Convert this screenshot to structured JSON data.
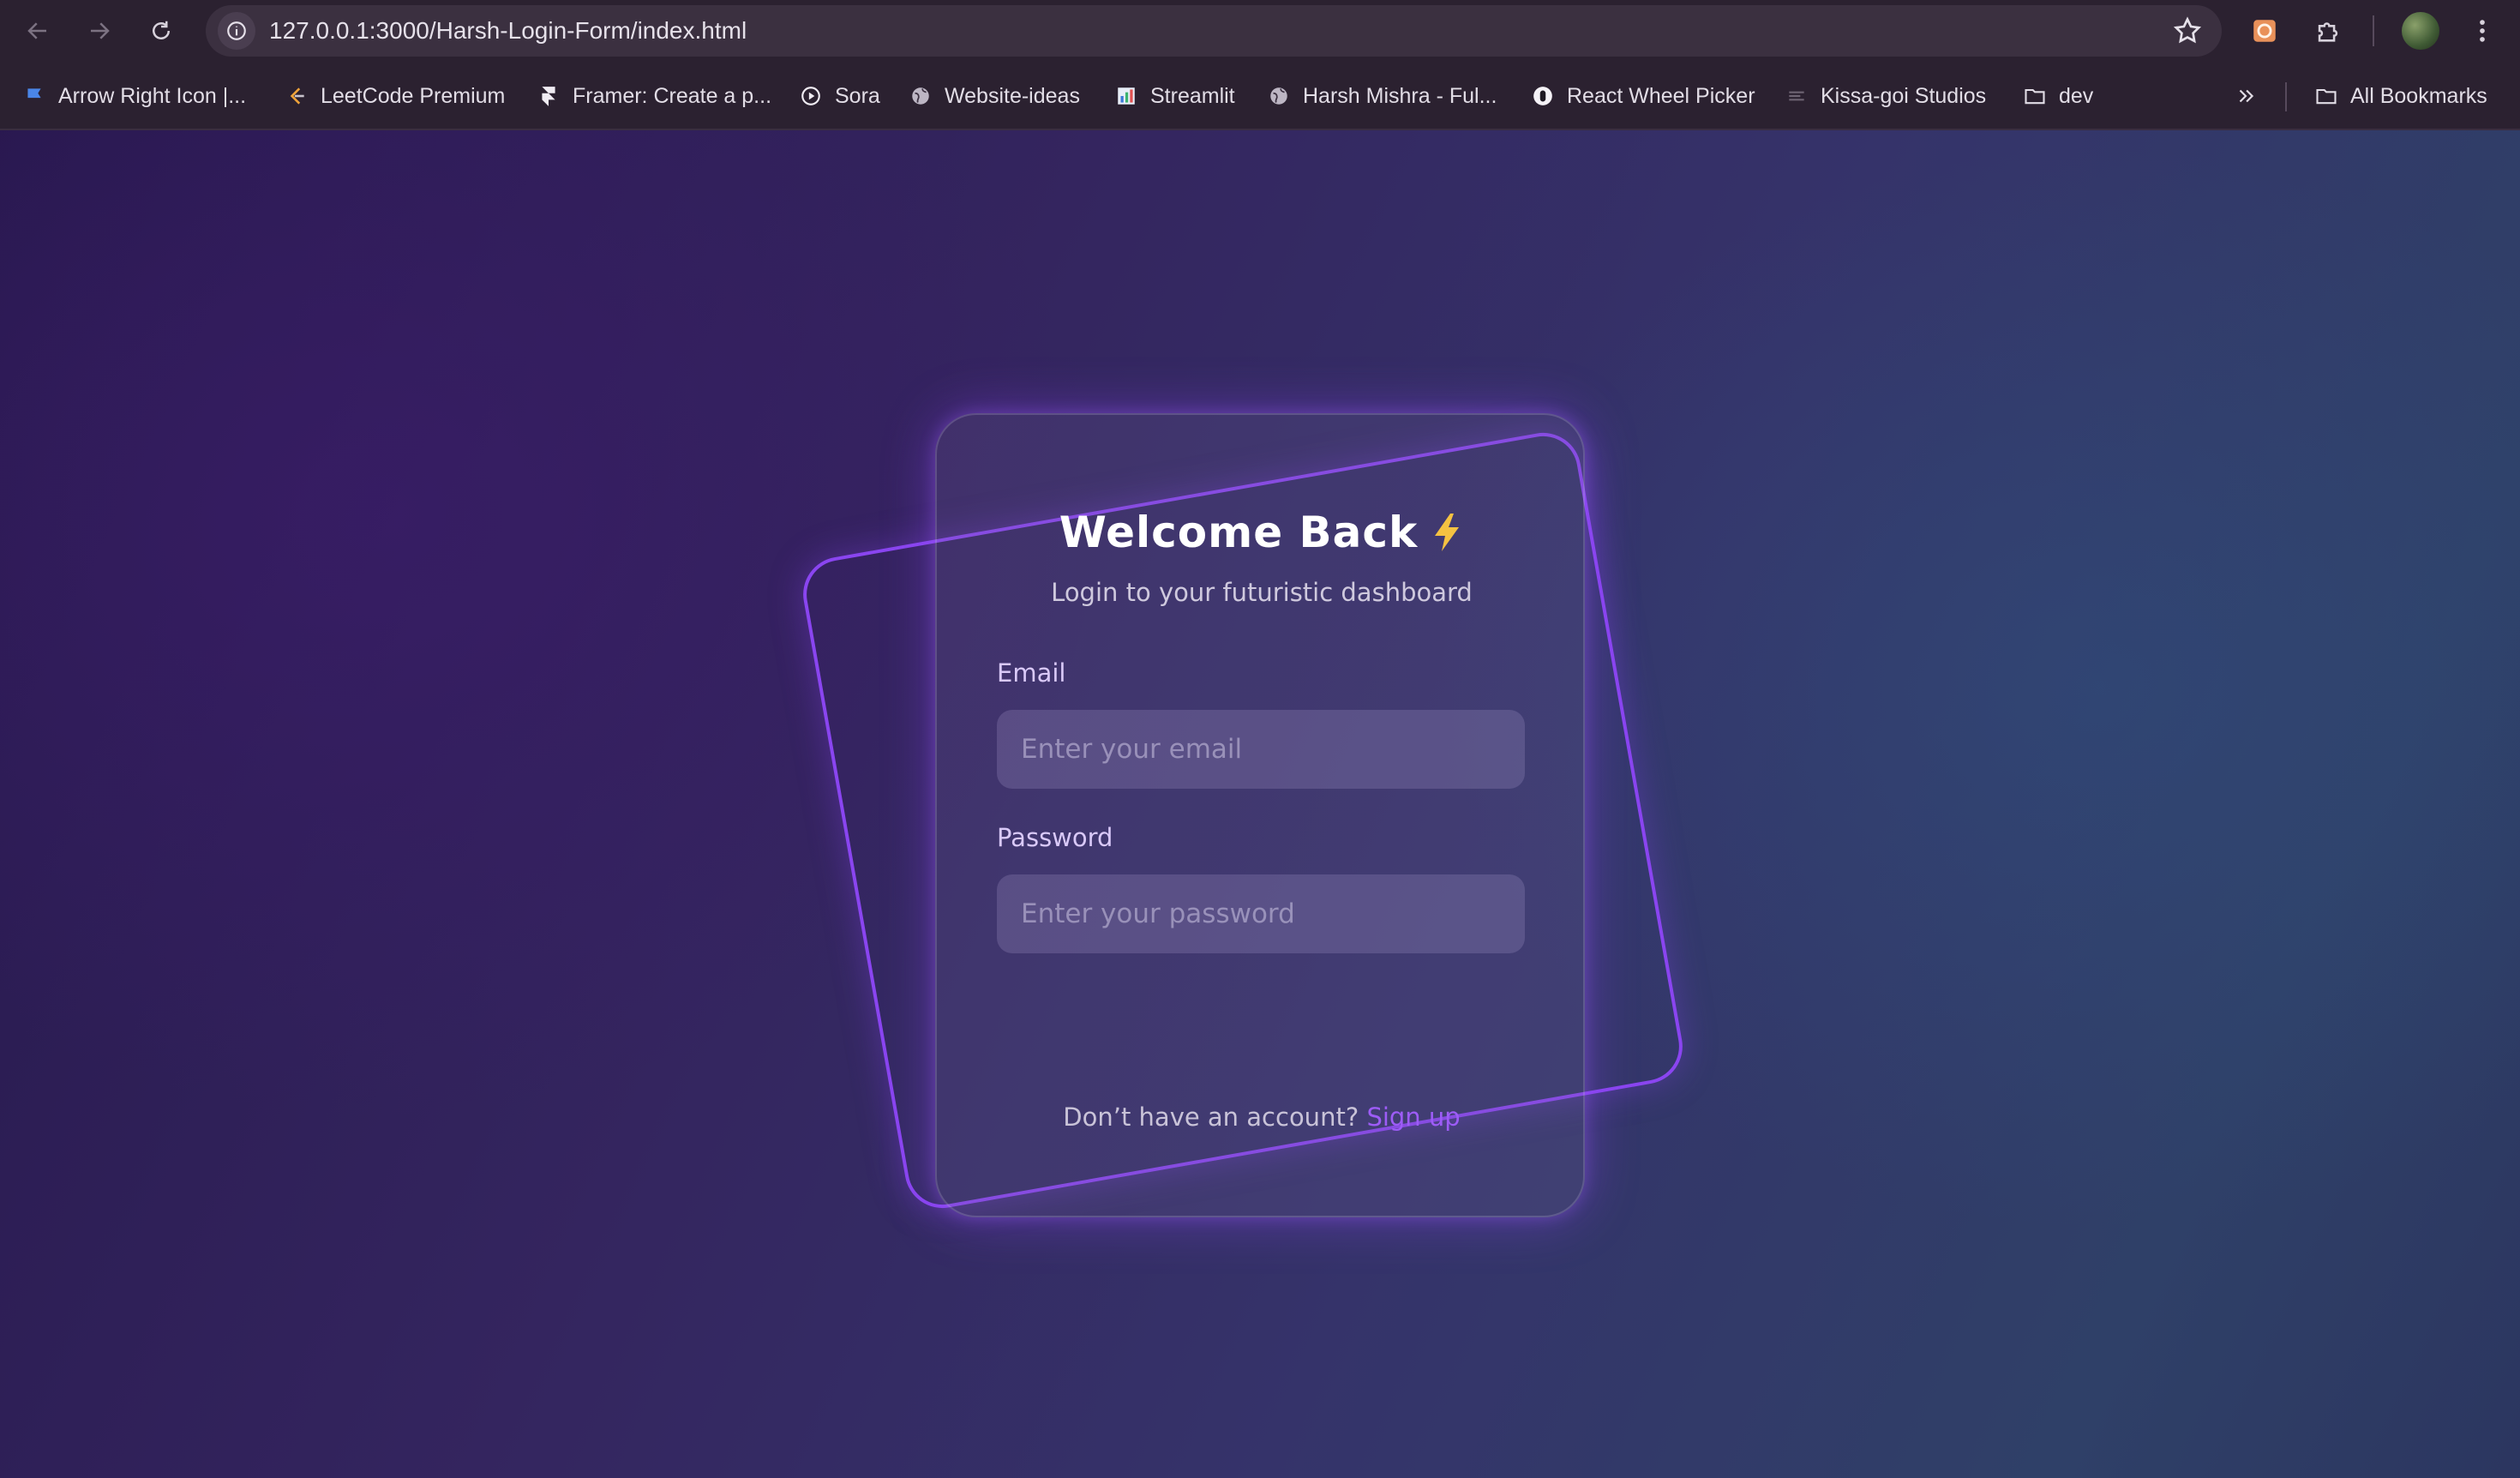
{
  "browser": {
    "url": "127.0.0.1:3000/Harsh-Login-Form/index.html",
    "bookmarks": [
      {
        "label": "Arrow Right Icon |...",
        "icon": "flag-icon"
      },
      {
        "label": "LeetCode Premium",
        "icon": "leetcode-icon"
      },
      {
        "label": "Framer: Create a p...",
        "icon": "framer-icon"
      },
      {
        "label": "Sora",
        "icon": "play-circle-icon"
      },
      {
        "label": "Website-ideas",
        "icon": "globe-icon"
      },
      {
        "label": "Streamlit",
        "icon": "bar-chart-icon"
      },
      {
        "label": "Harsh Mishra - Ful...",
        "icon": "globe-icon"
      },
      {
        "label": "React Wheel Picker",
        "icon": "wheel-picker-icon"
      },
      {
        "label": "Kissa-goi Studios",
        "icon": "studio-icon"
      },
      {
        "label": "dev",
        "icon": "folder-icon"
      }
    ],
    "all_bookmarks_label": "All Bookmarks"
  },
  "login": {
    "title": "Welcome Back",
    "subtitle": "Login to your futuristic dashboard",
    "email_label": "Email",
    "email_placeholder": "Enter your email",
    "email_value": "",
    "password_label": "Password",
    "password_placeholder": "Enter your password",
    "password_value": "",
    "footer_text": "Don’t have an account?",
    "signup_link": "Sign up"
  },
  "colors": {
    "accent": "#8a45f0",
    "link": "#9d5cf7",
    "bolt": "#f5c242"
  }
}
